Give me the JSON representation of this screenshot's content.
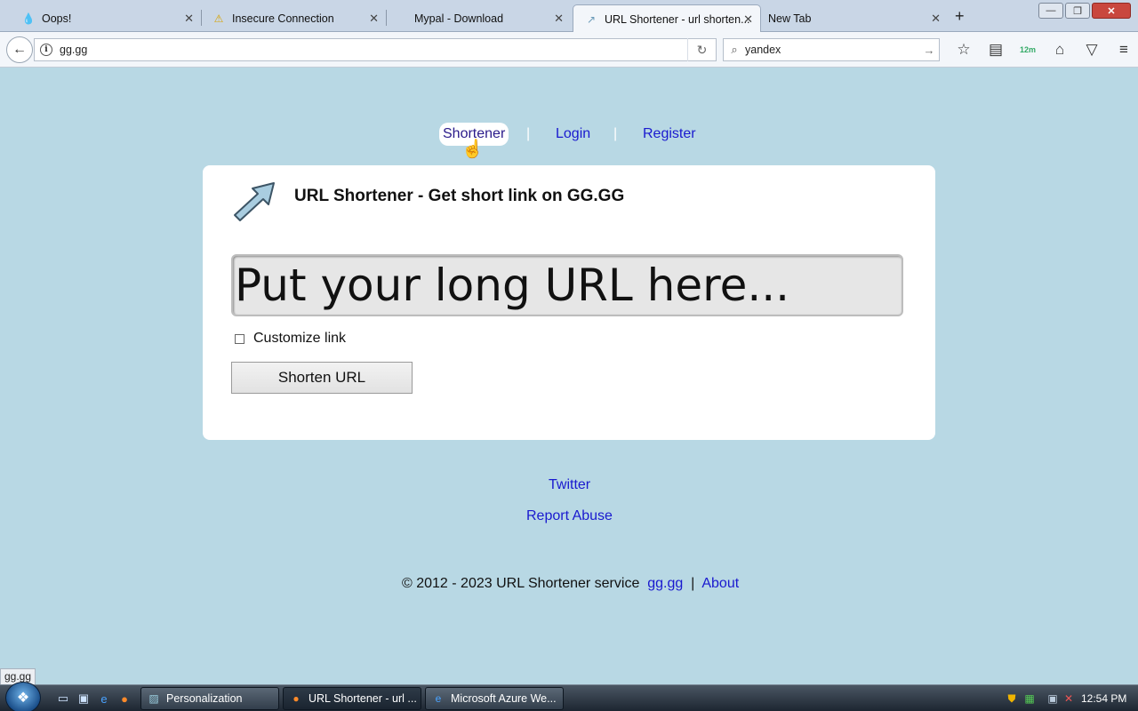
{
  "browser": {
    "tabs": [
      {
        "title": "Oops!",
        "icon": "globe-icon"
      },
      {
        "title": "Insecure Connection",
        "icon": "warning-icon"
      },
      {
        "title": "Mypal - Download",
        "icon": ""
      },
      {
        "title": "URL Shortener - url shorten...",
        "icon": "arrow-icon",
        "active": true
      },
      {
        "title": "New Tab",
        "icon": ""
      }
    ],
    "new_tab": "+",
    "url": "gg.gg",
    "search_value": "yandex",
    "toolbar_badge": "12m"
  },
  "page": {
    "nav": {
      "shortener": "Shortener",
      "login": "Login",
      "register": "Register",
      "sep": "|"
    },
    "title": "URL Shortener - Get short link on GG.GG",
    "url_input_placeholder": "Put your long URL here...",
    "customize_label": "Customize link",
    "shorten_button": "Shorten URL",
    "links": {
      "twitter": "Twitter",
      "report_abuse": "Report Abuse"
    },
    "footer": {
      "copyright": "© 2012 - 2023 URL Shortener service",
      "site": "gg.gg",
      "sep": "|",
      "about": "About"
    }
  },
  "status_tip": "gg.gg",
  "taskbar": {
    "buttons": [
      {
        "label": "Personalization"
      },
      {
        "label": "URL Shortener - url ..."
      },
      {
        "label": "Microsoft Azure We..."
      }
    ],
    "clock": "12:54 PM"
  },
  "colors": {
    "page_bg": "#b8d8e4",
    "link": "#1a1acf",
    "card_bg": "#ffffff"
  }
}
